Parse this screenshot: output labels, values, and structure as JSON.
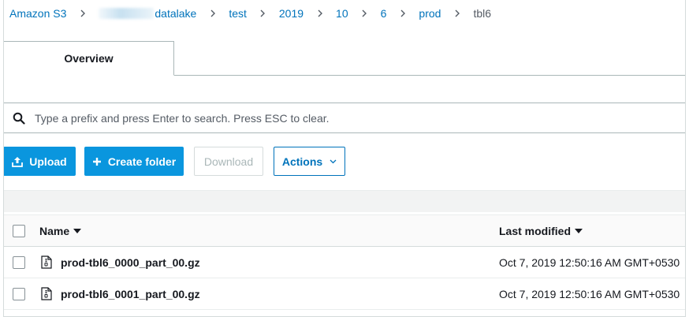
{
  "breadcrumb": {
    "items": [
      {
        "label": "Amazon S3"
      },
      {
        "label": "datalake"
      },
      {
        "label": "test"
      },
      {
        "label": "2019"
      },
      {
        "label": "10"
      },
      {
        "label": "6"
      },
      {
        "label": "prod"
      },
      {
        "label": "tbl6"
      }
    ]
  },
  "tabs": [
    {
      "label": "Overview"
    }
  ],
  "search": {
    "placeholder": "Type a prefix and press Enter to search. Press ESC to clear.",
    "value": ""
  },
  "toolbar": {
    "upload_label": "Upload",
    "create_folder_label": "Create folder",
    "download_label": "Download",
    "actions_label": "Actions"
  },
  "table": {
    "columns": [
      {
        "label": "Name"
      },
      {
        "label": "Last modified"
      }
    ],
    "rows": [
      {
        "name": "prod-tbl6_0000_part_00.gz",
        "last_modified": "Oct 7, 2019 12:50:16 AM GMT+0530"
      },
      {
        "name": "prod-tbl6_0001_part_00.gz",
        "last_modified": "Oct 7, 2019 12:50:16 AM GMT+0530"
      }
    ]
  },
  "colors": {
    "link": "#0073bb",
    "primary_button": "#0a96de",
    "border": "#aab7b8"
  },
  "icons": [
    "chevron-right-icon",
    "search-icon",
    "upload-icon",
    "plus-icon",
    "chevron-down-icon",
    "sort-caret-icon",
    "file-icon"
  ]
}
